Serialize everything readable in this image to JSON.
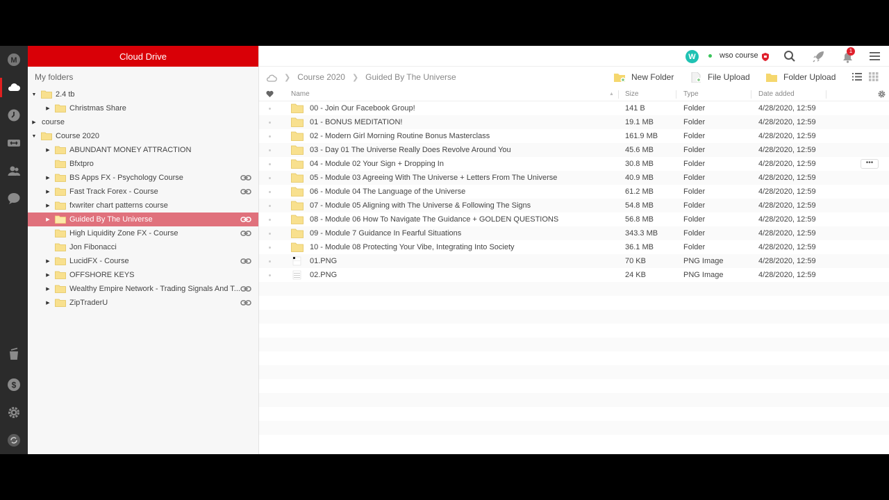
{
  "sidebar_title": "Cloud Drive",
  "tree_header": "My folders",
  "tree": [
    {
      "label": "2.4 tb",
      "depth": 0,
      "arrow": "down",
      "link": false,
      "selected": false
    },
    {
      "label": "Christmas Share",
      "depth": 1,
      "arrow": "right",
      "link": false,
      "selected": false
    },
    {
      "label": "course",
      "depth": 0,
      "arrow": "right",
      "link": false,
      "selected": false,
      "no_folder_icon": true
    },
    {
      "label": "Course 2020",
      "depth": 0,
      "arrow": "down",
      "link": false,
      "selected": false
    },
    {
      "label": "ABUNDANT MONEY ATTRACTION",
      "depth": 1,
      "arrow": "right",
      "link": false,
      "selected": false
    },
    {
      "label": "Bfxtpro",
      "depth": 1,
      "arrow": "",
      "link": false,
      "selected": false
    },
    {
      "label": "BS Apps FX - Psychology Course",
      "depth": 1,
      "arrow": "right",
      "link": true,
      "selected": false
    },
    {
      "label": "Fast Track Forex - Course",
      "depth": 1,
      "arrow": "right",
      "link": true,
      "selected": false
    },
    {
      "label": "fxwriter chart patterns course",
      "depth": 1,
      "arrow": "right",
      "link": false,
      "selected": false
    },
    {
      "label": "Guided By The Universe",
      "depth": 1,
      "arrow": "right",
      "link": true,
      "selected": true
    },
    {
      "label": "High Liquidity Zone FX - Course",
      "depth": 1,
      "arrow": "",
      "link": true,
      "selected": false
    },
    {
      "label": "Jon Fibonacci",
      "depth": 1,
      "arrow": "",
      "link": false,
      "selected": false
    },
    {
      "label": "LucidFX - Course",
      "depth": 1,
      "arrow": "right",
      "link": true,
      "selected": false
    },
    {
      "label": "OFFSHORE KEYS",
      "depth": 1,
      "arrow": "right",
      "link": false,
      "selected": false
    },
    {
      "label": "Wealthy Empire Network - Trading Signals And T...",
      "depth": 1,
      "arrow": "right",
      "link": true,
      "selected": false
    },
    {
      "label": "ZipTraderU",
      "depth": 1,
      "arrow": "right",
      "link": true,
      "selected": false
    }
  ],
  "topbar": {
    "avatar_letter": "W",
    "account_name": "wso course",
    "notification_count": "1"
  },
  "breadcrumbs": [
    "Course 2020",
    "Guided By The Universe"
  ],
  "toolbar": {
    "new_folder": "New Folder",
    "file_upload": "File Upload",
    "folder_upload": "Folder Upload"
  },
  "columns": {
    "name": "Name",
    "size": "Size",
    "type": "Type",
    "date": "Date added"
  },
  "files": [
    {
      "name": "00 - Join Our Facebook Group!",
      "size": "141 B",
      "type": "Folder",
      "date": "4/28/2020, 12:59",
      "kind": "folder"
    },
    {
      "name": "01 - BONUS MEDITATION!",
      "size": "19.1 MB",
      "type": "Folder",
      "date": "4/28/2020, 12:59",
      "kind": "folder"
    },
    {
      "name": "02 - Modern Girl Morning Routine Bonus Masterclass",
      "size": "161.9 MB",
      "type": "Folder",
      "date": "4/28/2020, 12:59",
      "kind": "folder"
    },
    {
      "name": "03 - Day 01 The Universe Really Does Revolve Around You",
      "size": "45.6 MB",
      "type": "Folder",
      "date": "4/28/2020, 12:59",
      "kind": "folder"
    },
    {
      "name": "04 - Module 02 Your Sign + Dropping In",
      "size": "30.8 MB",
      "type": "Folder",
      "date": "4/28/2020, 12:59",
      "kind": "folder",
      "more": "•••"
    },
    {
      "name": "05 - Module 03 Agreeing With The Universe + Letters From The Universe",
      "size": "40.9 MB",
      "type": "Folder",
      "date": "4/28/2020, 12:59",
      "kind": "folder"
    },
    {
      "name": "06 - Module 04 The Language of the Universe",
      "size": "61.2 MB",
      "type": "Folder",
      "date": "4/28/2020, 12:59",
      "kind": "folder"
    },
    {
      "name": "07 - Module 05 Aligning with The Universe & Following The Signs",
      "size": "54.8 MB",
      "type": "Folder",
      "date": "4/28/2020, 12:59",
      "kind": "folder"
    },
    {
      "name": "08 - Module 06 How To Navigate The Guidance + GOLDEN QUESTIONS",
      "size": "56.8 MB",
      "type": "Folder",
      "date": "4/28/2020, 12:59",
      "kind": "folder"
    },
    {
      "name": "09 - Module 7 Guidance In Fearful Situations",
      "size": "343.3 MB",
      "type": "Folder",
      "date": "4/28/2020, 12:59",
      "kind": "folder"
    },
    {
      "name": "10 - Module 08 Protecting Your Vibe, Integrating Into Society",
      "size": "36.1 MB",
      "type": "Folder",
      "date": "4/28/2020, 12:59",
      "kind": "folder"
    },
    {
      "name": "01.PNG",
      "size": "70 KB",
      "type": "PNG Image",
      "date": "4/28/2020, 12:59",
      "kind": "image"
    },
    {
      "name": "02.PNG",
      "size": "24 KB",
      "type": "PNG Image",
      "date": "4/28/2020, 12:59",
      "kind": "image"
    }
  ],
  "colors": {
    "brand_red": "#d90007",
    "selected_row": "#e0717c",
    "folder_yellow": "#f5d76e",
    "avatar_teal": "#1fc2b3"
  }
}
